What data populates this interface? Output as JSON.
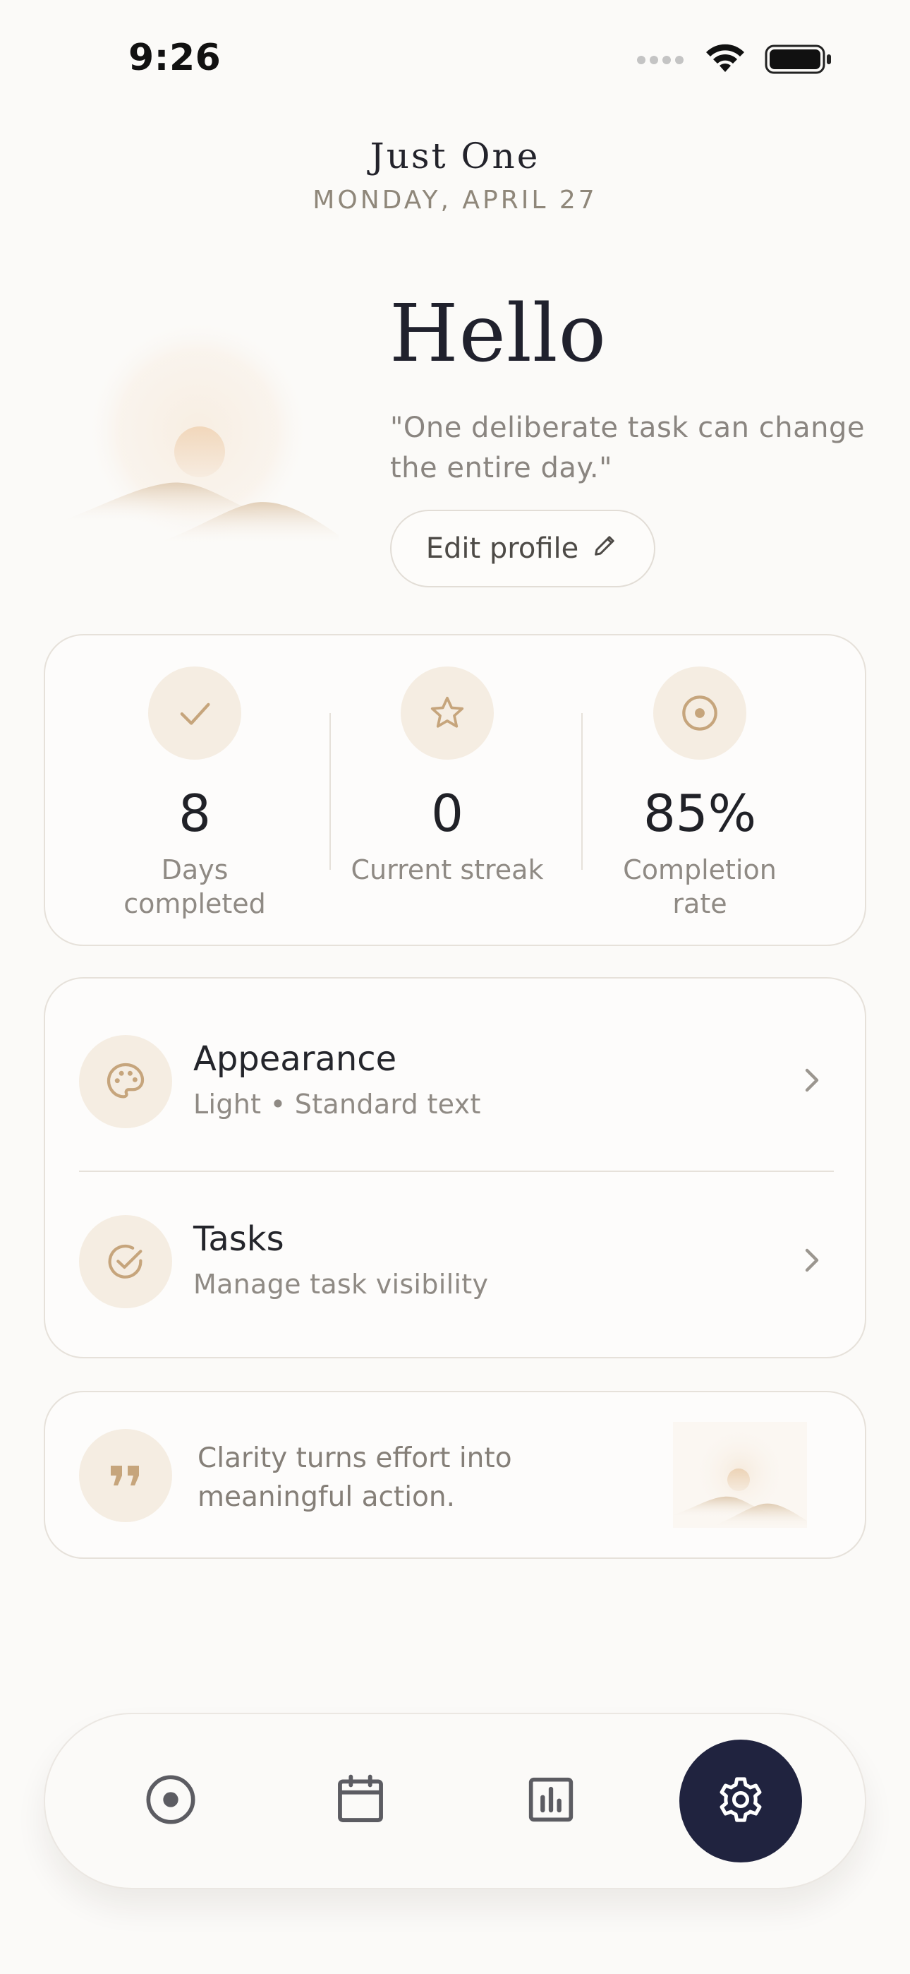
{
  "status_bar": {
    "time": "9:26",
    "icons": [
      "signal-icon",
      "wifi-icon",
      "battery-icon"
    ]
  },
  "header": {
    "app_title": "Just One",
    "date": "MONDAY, APRIL 27"
  },
  "hero": {
    "greeting": "Hello",
    "quote": "\"One deliberate task can change the entire day.\"",
    "edit_profile_label": "Edit profile"
  },
  "stats": [
    {
      "icon": "check-icon",
      "value": "8",
      "label": "Days completed"
    },
    {
      "icon": "star-icon",
      "value": "0",
      "label": "Current streak"
    },
    {
      "icon": "target-icon",
      "value": "85%",
      "label": "Completion rate"
    }
  ],
  "settings": [
    {
      "icon": "palette-icon",
      "title": "Appearance",
      "subtitle": "Light • Standard text"
    },
    {
      "icon": "check-circle-icon",
      "title": "Tasks",
      "subtitle": "Manage task visibility"
    }
  ],
  "quote_card": {
    "icon": "quote-icon",
    "text": "Clarity turns effort into meaningful action."
  },
  "tab_bar": {
    "tabs": [
      {
        "icon": "focus-icon",
        "active": false
      },
      {
        "icon": "calendar-icon",
        "active": false
      },
      {
        "icon": "stats-icon",
        "active": false
      },
      {
        "icon": "settings-gear-icon",
        "active": true
      }
    ]
  },
  "colors": {
    "background": "#fbfaf8",
    "accent": "#c6a57c",
    "icon_bg": "#f5ede2",
    "active_tab": "#20233f",
    "text_primary": "#1d1d24",
    "text_secondary": "#8f8a84"
  }
}
